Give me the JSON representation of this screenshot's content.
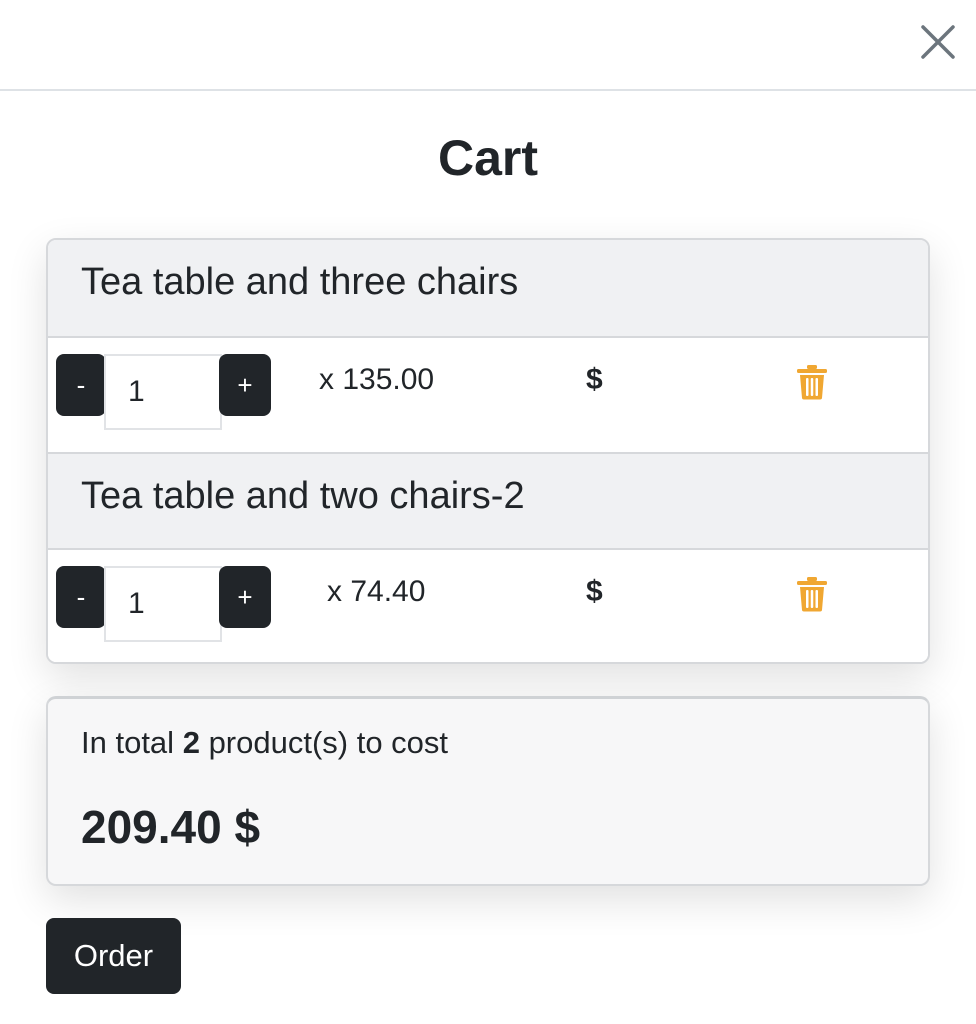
{
  "header": {
    "close_icon": "close-icon"
  },
  "cart": {
    "title": "Cart",
    "items": [
      {
        "name": "Tea table and three chairs",
        "quantity": "1",
        "minus_label": "-",
        "plus_label": "+",
        "price_text": "x 135.00",
        "currency": "$",
        "delete_icon": "trash-icon"
      },
      {
        "name": "Tea table and two chairs-2",
        "quantity": "1",
        "minus_label": "-",
        "plus_label": "+",
        "price_text": "x 74.40",
        "currency": "$",
        "delete_icon": "trash-icon"
      }
    ]
  },
  "summary": {
    "prefix": "In total",
    "count": "2",
    "suffix": "product(s) to cost",
    "amount": "209.40 $"
  },
  "actions": {
    "order_label": "Order"
  },
  "colors": {
    "dark": "#212529",
    "trash": "#f0a732",
    "header_bg": "#f0f1f3",
    "total_bg": "#f7f7f8"
  }
}
